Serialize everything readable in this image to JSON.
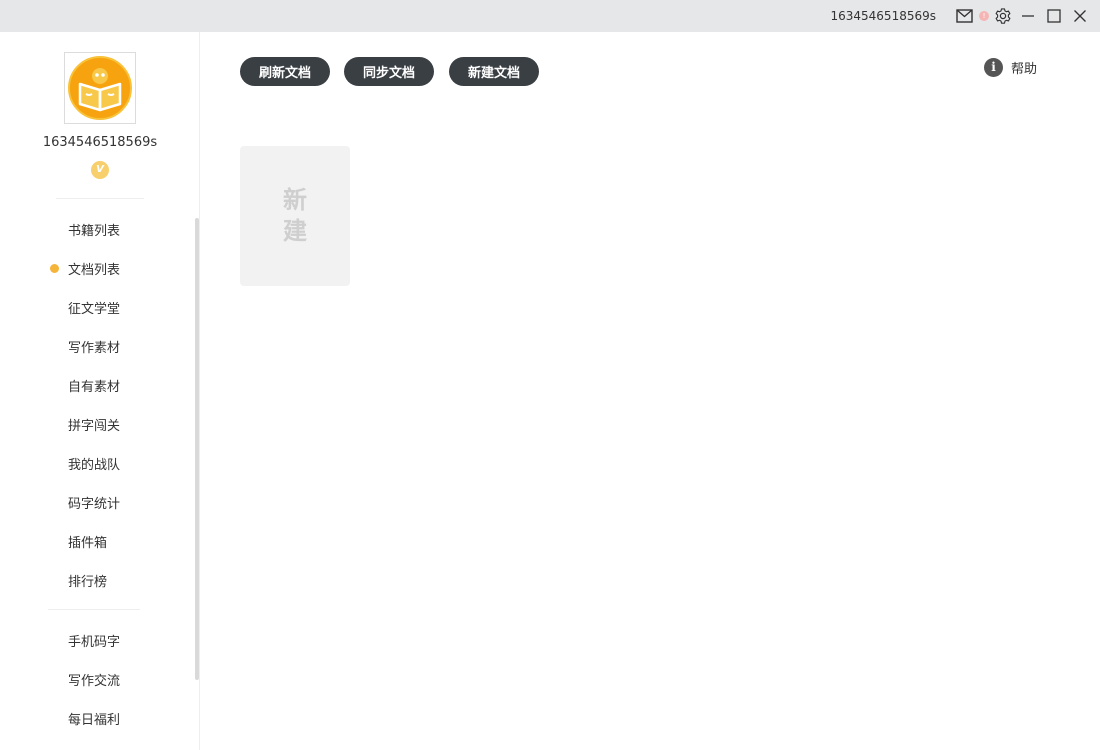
{
  "titlebar": {
    "username": "1634546518569s",
    "notification_badge": "!",
    "icons": [
      "mail-icon",
      "gear-icon",
      "minimize-icon",
      "maximize-icon",
      "close-icon"
    ]
  },
  "sidebar": {
    "username": "1634546518569s",
    "vip_label": "V",
    "items": [
      {
        "label": "书籍列表"
      },
      {
        "label": "文档列表",
        "active": true
      },
      {
        "label": "征文学堂"
      },
      {
        "label": "写作素材"
      },
      {
        "label": "自有素材"
      },
      {
        "label": "拼字闯关"
      },
      {
        "label": "我的战队"
      },
      {
        "label": "码字统计"
      },
      {
        "label": "插件箱"
      },
      {
        "label": "排行榜"
      }
    ],
    "secondary_items": [
      {
        "label": "手机码字"
      },
      {
        "label": "写作交流"
      },
      {
        "label": "每日福利"
      }
    ]
  },
  "toolbar": {
    "refresh_label": "刷新文档",
    "sync_label": "同步文档",
    "new_label": "新建文档",
    "help_label": "帮助",
    "help_icon_glyph": "i"
  },
  "content": {
    "new_card_label": "新建"
  },
  "colors": {
    "accent": "#f5b43a",
    "button_bg": "#3a3f44",
    "titlebar_bg": "#e6e7e9"
  }
}
